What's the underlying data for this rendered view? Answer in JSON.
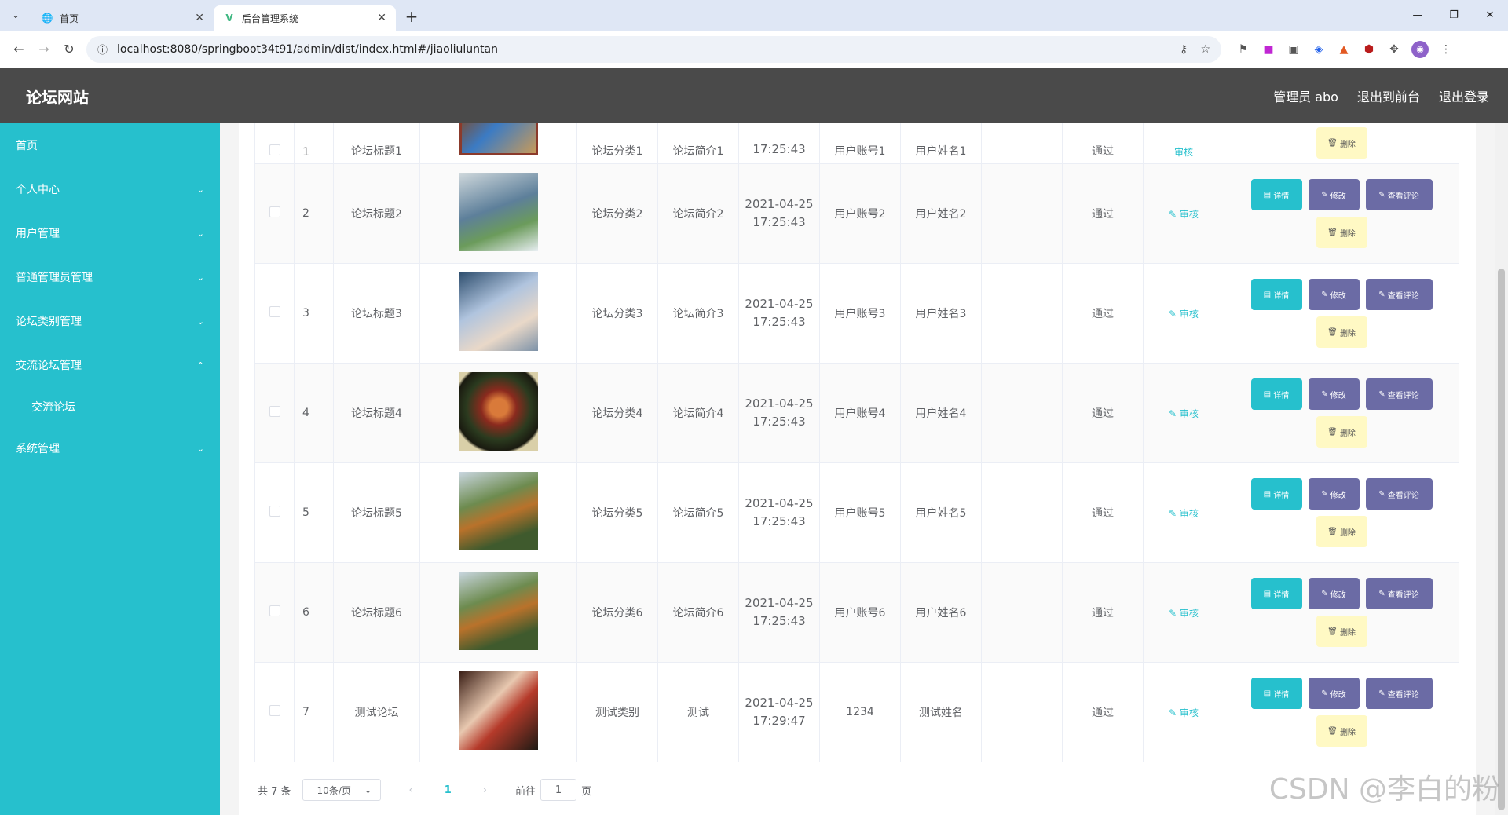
{
  "browser": {
    "tabs": [
      {
        "title": "首页",
        "active": false
      },
      {
        "title": "后台管理系统",
        "active": true
      }
    ],
    "url": "localhost:8080/springboot34t91/admin/dist/index.html#/jiaoliuluntan"
  },
  "header": {
    "title": "论坛网站",
    "user": "管理员 abo",
    "to_front": "退出到前台",
    "logout": "退出登录"
  },
  "sidebar": {
    "items": [
      {
        "label": "首页",
        "chevron": ""
      },
      {
        "label": "个人中心",
        "chevron": "⌄"
      },
      {
        "label": "用户管理",
        "chevron": "⌄"
      },
      {
        "label": "普通管理员管理",
        "chevron": "⌄"
      },
      {
        "label": "论坛类别管理",
        "chevron": "⌄"
      },
      {
        "label": "交流论坛管理",
        "chevron": "⌃"
      }
    ],
    "sub": "交流论坛",
    "last": {
      "label": "系统管理",
      "chevron": "⌄"
    }
  },
  "table": {
    "first_partial": {
      "idx": "1",
      "title": "论坛标题1",
      "cat": "论坛分类1",
      "intro": "论坛简介1",
      "time": "17:25:43",
      "account": "用户账号1",
      "name": "用户姓名1",
      "status": "通过",
      "audit": "审核",
      "del": "删除"
    },
    "rows": [
      {
        "idx": "2",
        "title": "论坛标题2",
        "cat": "论坛分类2",
        "intro": "论坛简介2",
        "date": "2021-04-25",
        "time": "17:25:43",
        "account": "用户账号2",
        "name": "用户姓名2",
        "status": "通过"
      },
      {
        "idx": "3",
        "title": "论坛标题3",
        "cat": "论坛分类3",
        "intro": "论坛简介3",
        "date": "2021-04-25",
        "time": "17:25:43",
        "account": "用户账号3",
        "name": "用户姓名3",
        "status": "通过"
      },
      {
        "idx": "4",
        "title": "论坛标题4",
        "cat": "论坛分类4",
        "intro": "论坛简介4",
        "date": "2021-04-25",
        "time": "17:25:43",
        "account": "用户账号4",
        "name": "用户姓名4",
        "status": "通过"
      },
      {
        "idx": "5",
        "title": "论坛标题5",
        "cat": "论坛分类5",
        "intro": "论坛简介5",
        "date": "2021-04-25",
        "time": "17:25:43",
        "account": "用户账号5",
        "name": "用户姓名5",
        "status": "通过"
      },
      {
        "idx": "6",
        "title": "论坛标题6",
        "cat": "论坛分类6",
        "intro": "论坛简介6",
        "date": "2021-04-25",
        "time": "17:25:43",
        "account": "用户账号6",
        "name": "用户姓名6",
        "status": "通过"
      },
      {
        "idx": "7",
        "title": "测试论坛",
        "cat": "测试类别",
        "intro": "测试",
        "date": "2021-04-25",
        "time": "17:29:47",
        "account": "1234",
        "name": "测试姓名",
        "status": "通过"
      }
    ],
    "actions": {
      "audit": "审核",
      "detail": "详情",
      "edit": "修改",
      "comment": "查看评论",
      "del": "删除"
    }
  },
  "pager": {
    "total": "共 7 条",
    "size": "10条/页",
    "current": "1",
    "goto": "前往",
    "page_input": "1",
    "page_unit": "页"
  },
  "watermark": "CSDN @李白的粉",
  "colors": {
    "sidebar": "#26c0cd",
    "header": "#4a4a4a",
    "btn_purple": "#6b6ba5",
    "btn_delete": "#fff9c4"
  }
}
